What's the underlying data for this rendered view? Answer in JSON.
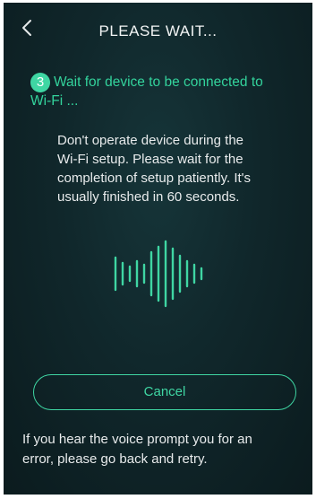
{
  "header": {
    "title": "PLEASE WAIT...",
    "back_icon": "chevron-left-icon"
  },
  "step": {
    "number": "3",
    "line1": "Wait for device to be connected to",
    "line2": "Wi-Fi ..."
  },
  "description": {
    "line1": "Don't operate device during the",
    "line2": "Wi-Fi setup. Please wait for the",
    "line3": "completion of setup patiently. It's",
    "line4": "usually finished in 60 seconds."
  },
  "waveform_icon": "sound-wave-icon",
  "cancel_label": "Cancel",
  "footer": {
    "line1": "If you hear the voice prompt you for an",
    "line2": "error, please go back and retry."
  },
  "colors": {
    "accent": "#3fd6a3",
    "background": "#10272b",
    "text": "#e8ebec"
  }
}
